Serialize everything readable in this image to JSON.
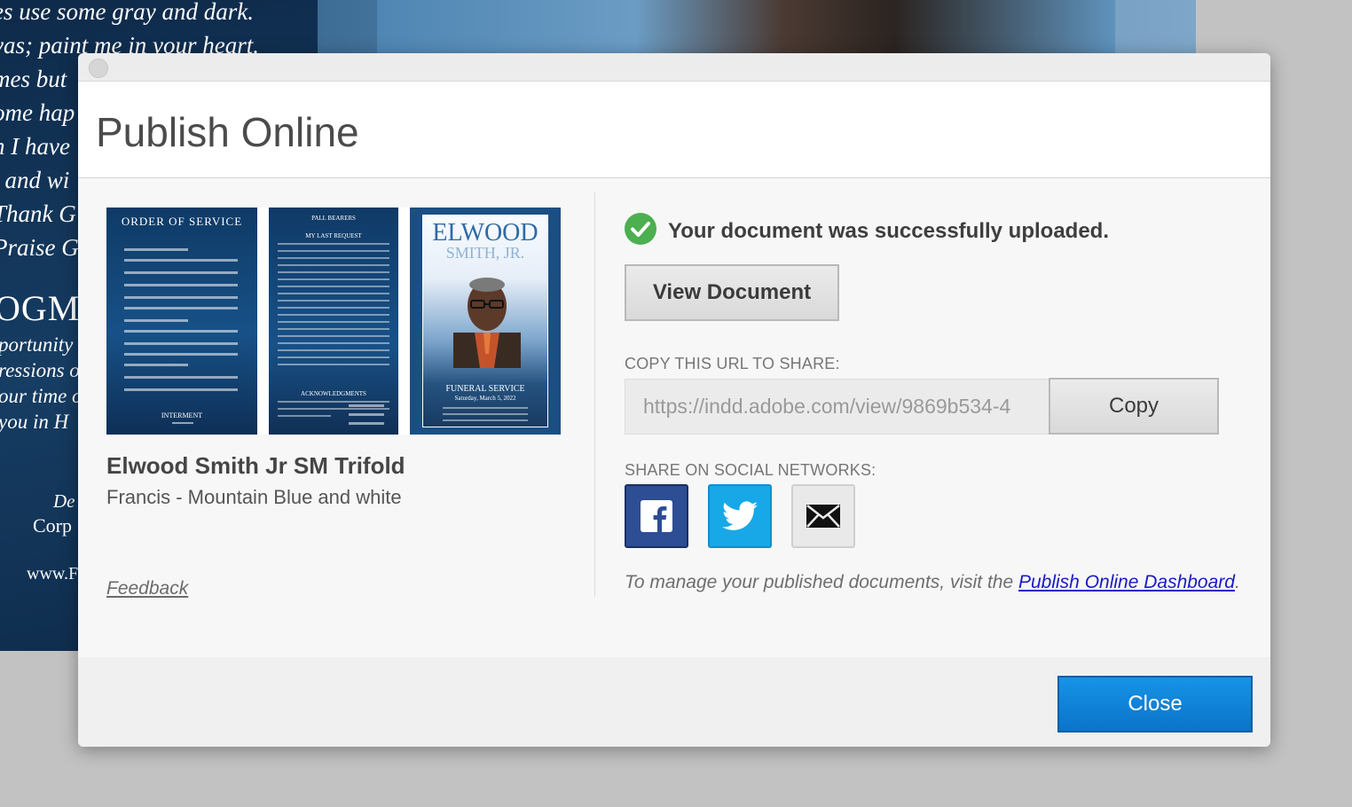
{
  "background_document": {
    "poem_lines": [
      "es use some gray and dark.",
      "vas; paint me in your heart.",
      "mes but",
      "ome hap",
      "n I have",
      ", and wi",
      "Thank G",
      "Praise Go"
    ],
    "section_heading": "OGMI",
    "acknowledgment_lines": [
      "portunity",
      "ressions of",
      "our time o",
      "you in H"
    ],
    "credit_1": "De",
    "credit_2": "Corp",
    "credit_3": "www.F"
  },
  "dialog": {
    "title": "Publish Online",
    "document": {
      "name": "Elwood Smith Jr SM Trifold",
      "template": "Francis - Mountain Blue and white"
    },
    "thumbnail": {
      "panel1_heading": "ORDER OF SERVICE",
      "panel1_footer": "INTERMENT",
      "panel2_heading": "PALL BEARERS",
      "panel2_subheading": "MY LAST REQUEST",
      "panel2_section": "ACKNOWLEDGMENTS",
      "cover_first_name": "ELWOOD",
      "cover_last_name": "SMITH, JR.",
      "cover_service": "FUNERAL SERVICE",
      "cover_date": "Saturday, March 5, 2022"
    },
    "feedback_label": "Feedback",
    "status_message": "Your document was successfully uploaded.",
    "view_document_label": "View Document",
    "url_label": "COPY THIS URL TO SHARE:",
    "url_value": "https://indd.adobe.com/view/9869b534-4",
    "copy_label": "Copy",
    "social_label": "SHARE ON SOCIAL NETWORKS:",
    "social_icons": [
      "facebook-icon",
      "twitter-icon",
      "email-icon"
    ],
    "manage_text": "To manage your published documents, visit the ",
    "dashboard_link": "Publish Online Dashboard",
    "manage_suffix": ".",
    "close_label": "Close"
  },
  "colors": {
    "primary_button": "#0a74c9",
    "success": "#4caf50",
    "facebook": "#2d4d94",
    "twitter": "#18a8e8",
    "link": "#1a1ac6"
  }
}
